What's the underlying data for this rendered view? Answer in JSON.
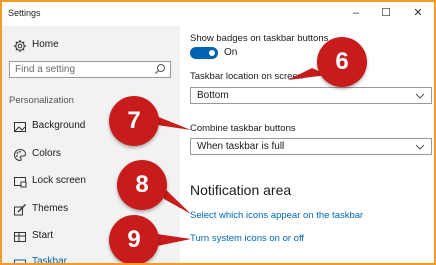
{
  "window": {
    "title": "Settings",
    "minimize": "–",
    "maximize": "☐",
    "close": "✕"
  },
  "sidebar": {
    "home": "Home",
    "search_placeholder": "Find a setting",
    "section": "Personalization",
    "items": [
      {
        "label": "Background",
        "icon": "picture-icon"
      },
      {
        "label": "Colors",
        "icon": "palette-icon"
      },
      {
        "label": "Lock screen",
        "icon": "lock-screen-icon"
      },
      {
        "label": "Themes",
        "icon": "brush-icon"
      },
      {
        "label": "Start",
        "icon": "start-icon"
      },
      {
        "label": "Taskbar",
        "icon": "taskbar-icon"
      }
    ]
  },
  "content": {
    "badges_label": "Show badges on taskbar buttons",
    "badges_toggle": "On",
    "location_label": "Taskbar location on screen",
    "location_value": "Bottom",
    "combine_label": "Combine taskbar buttons",
    "combine_value": "When taskbar is full",
    "notification_heading": "Notification area",
    "link_icons": "Select which icons appear on the taskbar",
    "link_system": "Turn system icons on or off"
  },
  "callouts": [
    "6",
    "7",
    "8",
    "9"
  ],
  "colors": {
    "accent": "#0063b1",
    "link": "#0067b8",
    "callout": "#c81b1b",
    "frame": "#f39a2b"
  }
}
